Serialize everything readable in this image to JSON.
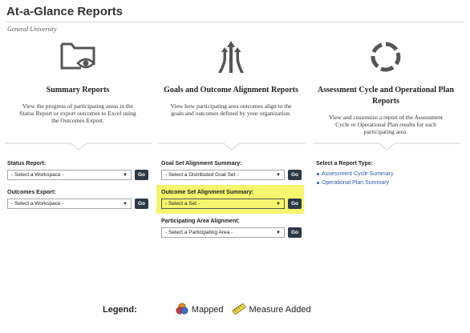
{
  "header": {
    "title": "At-a-Glance Reports",
    "subtitle": "General University"
  },
  "cards": [
    {
      "icon": "folder-eye-icon",
      "title": "Summary Reports",
      "description": "View the progress of participating areas in the Status Report or export outcomes to Excel using the Outcomes Export."
    },
    {
      "icon": "converging-arrows-icon",
      "title": "Goals and Outcome Alignment Reports",
      "description": "View how participating area outcomes align to the goals and outcomes defined by your organization."
    },
    {
      "icon": "cycle-icon",
      "title": "Assessment Cycle and Operational Plan Reports",
      "description": "View and customize a report of the Assessment Cycle or Operational Plan results for each participating area."
    }
  ],
  "summary": {
    "status_label": "Status Report:",
    "status_select": "- Select a Workspace -",
    "outcomes_label": "Outcomes Export:",
    "outcomes_select": "- Select a Workspace -"
  },
  "alignment": {
    "goal_label": "Goal Set Alignment Summary:",
    "goal_select": "- Select a Distributed Goal Set -",
    "outcome_label": "Outcome Set Alignment Summary:",
    "outcome_select": "- Select a Set -",
    "area_label": "Participating Area Alignment:",
    "area_select": "- Select a Participating Area -"
  },
  "cycle": {
    "type_label": "Select a Report Type:",
    "links": [
      "Assessment Cycle Summary",
      "Operational Plan Summary"
    ]
  },
  "go_label": "Go",
  "legend": {
    "label": "Legend:",
    "items": [
      {
        "icon": "mapped-icon",
        "label": "Mapped"
      },
      {
        "icon": "ruler-icon",
        "label": "Measure Added"
      }
    ]
  },
  "colors": {
    "go_button": "#2c3a48",
    "highlight": "#f5f56e",
    "link": "#2a5db0"
  }
}
